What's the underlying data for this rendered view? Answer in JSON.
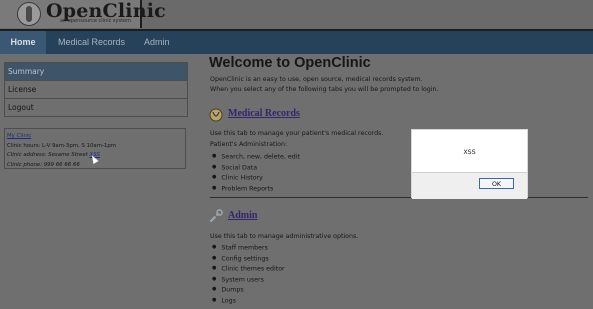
{
  "header": {
    "app_name": "OpenClinic",
    "tagline": "an opensource clinic system"
  },
  "nav": {
    "tabs": [
      "Home",
      "Medical Records",
      "Admin"
    ],
    "active": "Home"
  },
  "sidebar": {
    "items": [
      {
        "label": "Summary",
        "active": true
      },
      {
        "label": "License",
        "active": false
      },
      {
        "label": "Logout",
        "active": false
      }
    ],
    "clinic": {
      "name": "My Clinic",
      "hours": "Clinic hours: L-V 9am-3pm, S 10am-1pm",
      "address_label": "Clinic address: Sesame Street ",
      "address_link": "XSS",
      "phone": "Clinic phone: 999 66 66 66"
    }
  },
  "main": {
    "title": "Welcome to OpenClinic",
    "intro1": "OpenClinic is an easy to use, open source, medical records system.",
    "intro2": "When you select any of the following tabs you will be prompted to login.",
    "medical": {
      "title": "Medical Records",
      "desc": "Use this tab to manage your patient's medical records.",
      "sub": "Patient's Administration:",
      "items": [
        "Search, new, delete, edit",
        "Social Data",
        "Clinic History",
        "Problem Reports"
      ]
    },
    "admin": {
      "title": "Admin",
      "desc": "Use this tab to manage administrative options.",
      "items": [
        "Staff members",
        "Config settings",
        "Clinic themes editor",
        "System users",
        "Dumps",
        "Logs"
      ]
    }
  },
  "dialog": {
    "message": "XSS",
    "ok_label": "OK"
  },
  "icons": {
    "medical": "stethoscope-icon",
    "admin": "wrench-icon"
  },
  "colors": {
    "nav_bg": "#26415a",
    "link": "#35256d",
    "overlay": "#6f6f6f"
  }
}
